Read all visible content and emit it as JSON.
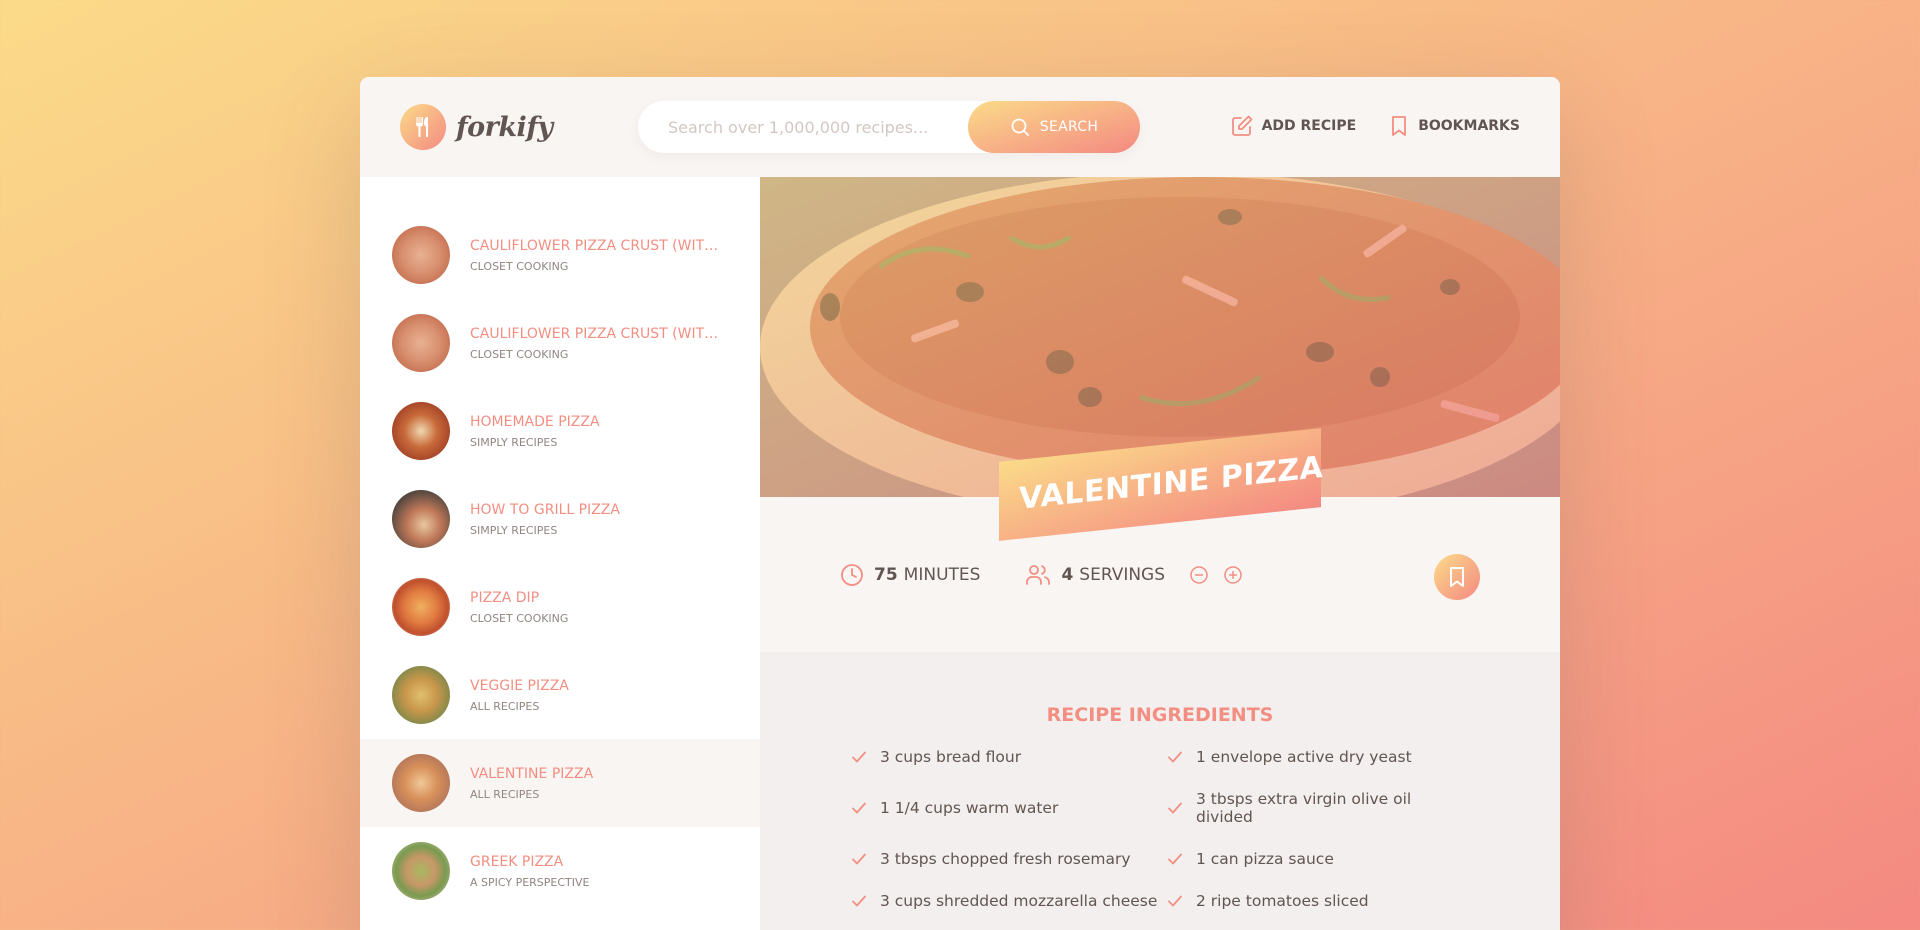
{
  "header": {
    "logo_text": "forkify",
    "search_placeholder": "Search over 1,000,000 recipes...",
    "search_button": "Search",
    "nav": {
      "add_recipe": "Add recipe",
      "bookmarks": "Bookmarks"
    }
  },
  "results": [
    {
      "title": "Cauliflower Pizza Crust (with BBQ Chicken Pizza)",
      "publisher": "Closet Cooking"
    },
    {
      "title": "Cauliflower Pizza Crust (with BBQ Chicken Pizza)",
      "publisher": "Closet Cooking"
    },
    {
      "title": "Homemade Pizza",
      "publisher": "Simply Recipes"
    },
    {
      "title": "How to Grill Pizza",
      "publisher": "Simply Recipes"
    },
    {
      "title": "Pizza Dip",
      "publisher": "Closet Cooking"
    },
    {
      "title": "Veggie Pizza",
      "publisher": "All Recipes"
    },
    {
      "title": "Valentine Pizza",
      "publisher": "All Recipes"
    },
    {
      "title": "Greek Pizza",
      "publisher": "A Spicy Perspective"
    }
  ],
  "recipe": {
    "title": "Valentine Pizza",
    "minutes_value": "75",
    "minutes_label": "minutes",
    "servings_value": "4",
    "servings_label": "servings",
    "ingredients_heading": "Recipe ingredients",
    "ingredients": [
      "3 cups bread flour",
      "1 envelope active dry yeast",
      "1 1/4 cups warm water",
      "3 tbsps extra virgin olive oil divided",
      "3 tbsps chopped fresh rosemary",
      "1 can pizza sauce",
      "3 cups shredded mozzarella cheese",
      "2 ripe tomatoes sliced"
    ]
  },
  "colors": {
    "accent": "#f38e82",
    "grad_start": "#fbdb89",
    "grad_end": "#f48982",
    "text": "#615551"
  }
}
